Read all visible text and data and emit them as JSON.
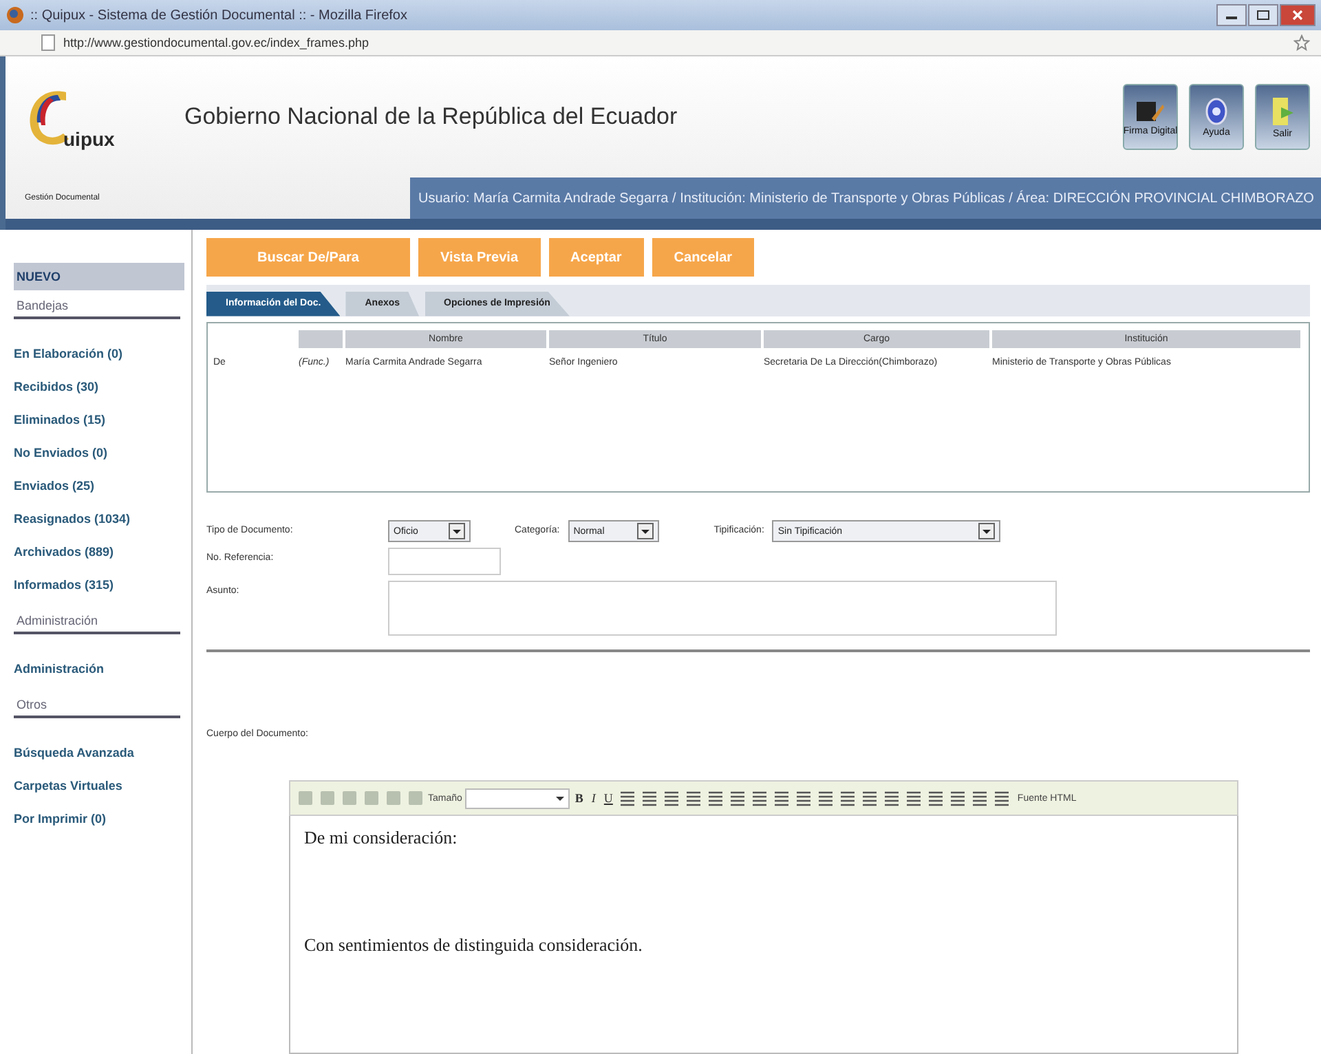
{
  "window": {
    "title": ":: Quipux - Sistema de Gestión Documental :: - Mozilla Firefox",
    "url": "http://www.gestiondocumental.gov.ec/index_frames.php"
  },
  "header": {
    "logo_text": "uipux",
    "logo_subtitle": "Gestión Documental",
    "title": "Gobierno Nacional de la República del Ecuador",
    "tools": [
      {
        "kind": "signature",
        "label": "Firma Digital"
      },
      {
        "kind": "help",
        "label": "Ayuda"
      },
      {
        "kind": "exit",
        "label": "Salir"
      }
    ],
    "user_info": "Usuario: María Carmita Andrade Segarra / Institución: Ministerio de Transporte y Obras Públicas / Área: DIRECCIÓN PROVINCIAL CHIMBORAZO"
  },
  "sidebar": [
    {
      "kind": "new",
      "label": "NUEVO",
      "selected": true
    },
    {
      "kind": "section",
      "label": "Bandejas"
    },
    {
      "kind": "item",
      "label": "En Elaboración (0)",
      "selected": false
    },
    {
      "kind": "item",
      "label": "Recibidos (30)",
      "selected": false
    },
    {
      "kind": "item",
      "label": "Eliminados (15)",
      "selected": false
    },
    {
      "kind": "item",
      "label": "No Enviados (0)",
      "selected": false
    },
    {
      "kind": "item",
      "label": "Enviados (25)",
      "selected": false
    },
    {
      "kind": "item",
      "label": "Reasignados (1034)",
      "selected": false
    },
    {
      "kind": "item",
      "label": "Archivados (889)",
      "selected": false
    },
    {
      "kind": "item",
      "label": "Informados (315)",
      "selected": false
    },
    {
      "kind": "section",
      "label": "Administración"
    },
    {
      "kind": "item",
      "label": "Administración",
      "selected": false
    },
    {
      "kind": "section",
      "label": "Otros"
    },
    {
      "kind": "item",
      "label": "Búsqueda Avanzada",
      "selected": false
    },
    {
      "kind": "item",
      "label": "Carpetas Virtuales",
      "selected": false
    },
    {
      "kind": "item",
      "label": "Por Imprimir (0)",
      "selected": false
    }
  ],
  "actions": [
    {
      "label": "Buscar De/Para",
      "wide": true
    },
    {
      "label": "Vista Previa",
      "wide": false
    },
    {
      "label": "Aceptar",
      "wide": false
    },
    {
      "label": "Cancelar",
      "wide": false
    }
  ],
  "tabs": [
    {
      "label": "Información del Doc.",
      "selected": true
    },
    {
      "label": "Anexos",
      "selected": false
    },
    {
      "label": "Opciones de Impresión",
      "selected": false
    }
  ],
  "table": {
    "columns": [
      {
        "kind": "none"
      },
      {
        "kind": "blank"
      },
      {
        "kind": "label",
        "label": "Nombre"
      },
      {
        "kind": "label",
        "label": "Título"
      },
      {
        "kind": "label",
        "label": "Cargo"
      },
      {
        "kind": "label",
        "label": "Institución"
      }
    ],
    "rows": [
      [
        "De",
        "(Func.)",
        "María Carmita Andrade Segarra",
        "Señor Ingeniero",
        "Secretaria De La Dirección(Chimborazo)",
        "Ministerio de Transporte y Obras Públicas"
      ]
    ]
  },
  "form": {
    "document_type": {
      "label": "Tipo de Documento:",
      "value": "Oficio"
    },
    "category": {
      "label": "Categoría:",
      "value": "Normal"
    },
    "typification": {
      "label": "Tipificación:",
      "value": "Sin Tipificación"
    },
    "reference": {
      "label": "No. Referencia:"
    },
    "subject": {
      "label": "Asunto:"
    },
    "body_label": "Cuerpo del Documento:"
  },
  "editor": {
    "size_label": "Tamaño",
    "bold": "B",
    "italic": "I",
    "underline": "U",
    "source_label": "Fuente HTML",
    "paragraphs": [
      "De mi consideración:",
      "Con sentimientos de distinguida consideración."
    ]
  }
}
